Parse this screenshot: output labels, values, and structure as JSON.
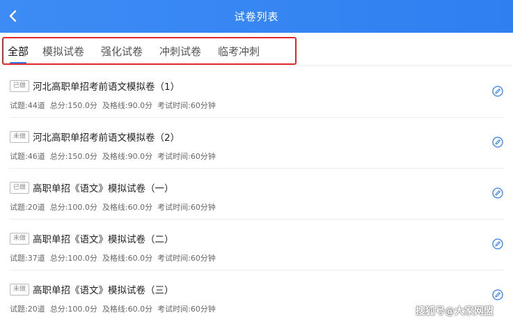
{
  "header": {
    "title": "试卷列表"
  },
  "tabs": [
    {
      "label": "全部",
      "active": true
    },
    {
      "label": "模拟试卷",
      "active": false
    },
    {
      "label": "强化试卷",
      "active": false
    },
    {
      "label": "冲刺试卷",
      "active": false
    },
    {
      "label": "临考冲刺",
      "active": false
    }
  ],
  "exams": [
    {
      "status": "已做",
      "title": "河北高职单招考前语文模拟卷（1）",
      "questions": "试题:44道",
      "total": "总分:150.0分",
      "pass": "及格线:90.0分",
      "time": "考试时间:60分钟"
    },
    {
      "status": "未做",
      "title": "河北高职单招考前语文模拟卷（2）",
      "questions": "试题:46道",
      "total": "总分:150.0分",
      "pass": "及格线:90.0分",
      "time": "考试时间:60分钟"
    },
    {
      "status": "已做",
      "title": "高职单招《语文》模拟试卷（一）",
      "questions": "试题:20道",
      "total": "总分:100.0分",
      "pass": "及格线:60.0分",
      "time": "考试时间:60分钟"
    },
    {
      "status": "未做",
      "title": "高职单招《语文》模拟试卷（二）",
      "questions": "试题:37道",
      "total": "总分:100.0分",
      "pass": "及格线:60.0分",
      "time": "考试时间:60分钟"
    },
    {
      "status": "未做",
      "title": "高职单招《语文》模拟试卷（三）",
      "questions": "试题:20道",
      "total": "总分:100.0分",
      "pass": "及格线:60.0分",
      "time": "考试时间:60分钟"
    }
  ],
  "watermark": "搜狐号@大家网盟",
  "colors": {
    "header": "#2f7ff1",
    "highlight": "#e3262a",
    "icon": "#2f7ff1"
  }
}
